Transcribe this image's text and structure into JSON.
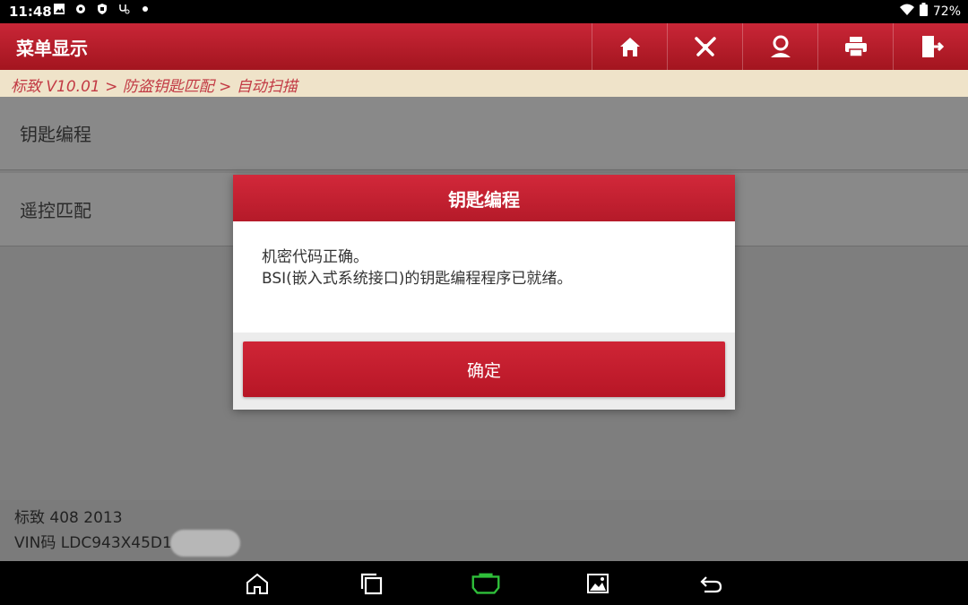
{
  "status_bar": {
    "time": "11:48",
    "battery": "72%",
    "icons": [
      "image-icon",
      "gear-icon",
      "shield-icon",
      "stethoscope-icon",
      "dot-icon",
      "wifi-icon",
      "battery-icon"
    ]
  },
  "header": {
    "title": "菜单显示",
    "tools": [
      "home-icon",
      "diagnostic-icon",
      "user-icon",
      "printer-icon",
      "exit-icon"
    ]
  },
  "breadcrumb": "标致 V10.01 > 防盗钥匙匹配 > 自动扫描",
  "menu": {
    "items": [
      {
        "label": "钥匙编程"
      },
      {
        "label": "遥控匹配"
      }
    ]
  },
  "footer": {
    "vehicle": "标致 408 2013",
    "vin": "VIN码 LDC943X45D1"
  },
  "dialog": {
    "title": "钥匙编程",
    "line1": "机密代码正确。",
    "line2": "BSI(嵌入式系统接口)的钥匙编程程序已就绪。",
    "ok_label": "确定"
  },
  "navbar": {
    "icons": [
      "home-icon",
      "recents-icon",
      "vci-icon",
      "gallery-icon",
      "back-icon"
    ],
    "vci_label": "VCI"
  },
  "colors": {
    "brand_red": "#c0192a",
    "vci_green": "#2fbf3a"
  }
}
